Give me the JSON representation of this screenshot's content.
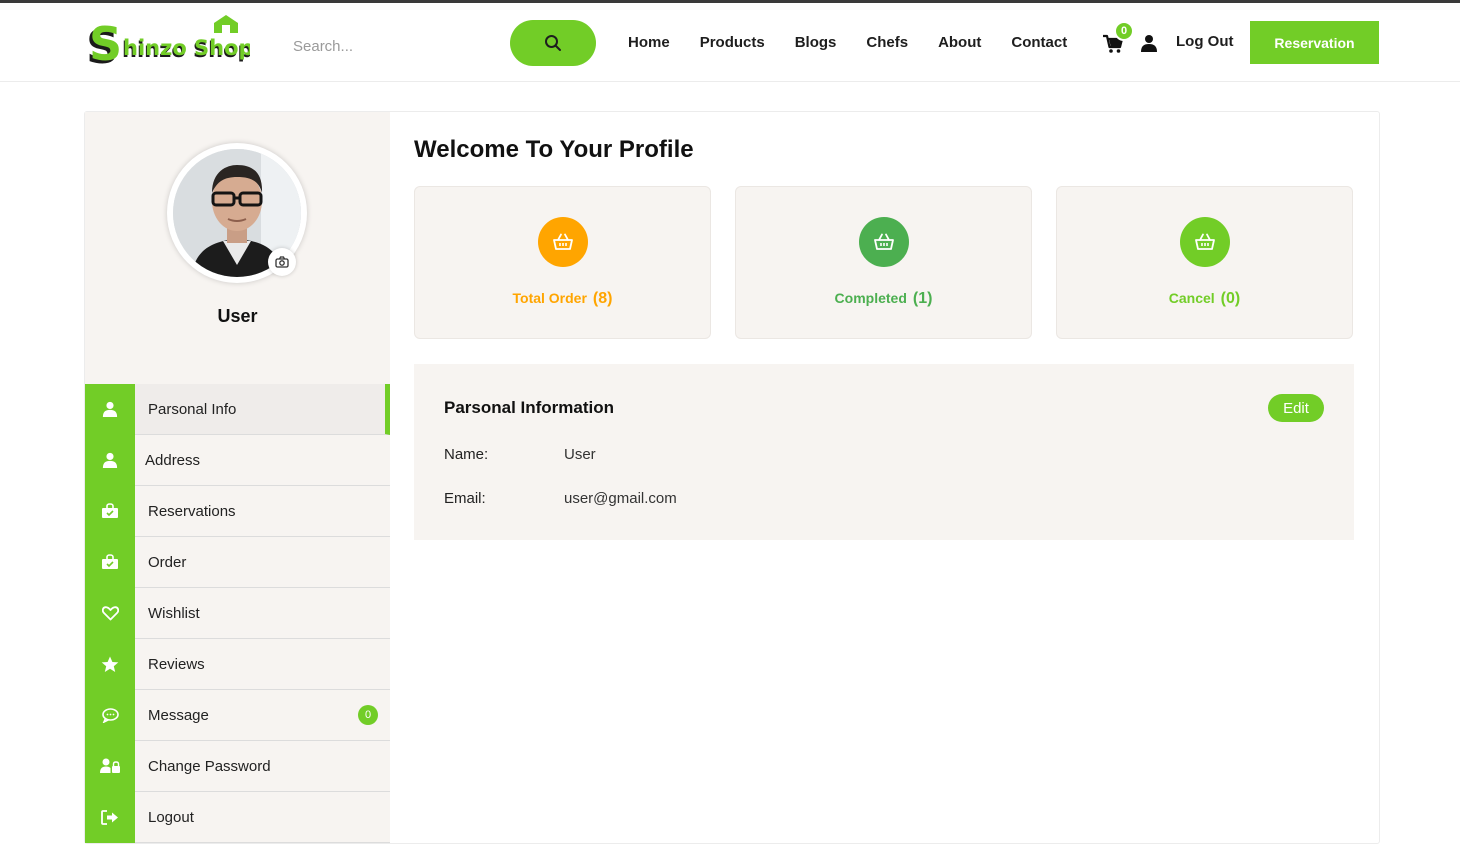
{
  "brand": {
    "name": "Shinzo Shop",
    "accent": "#72cd27"
  },
  "search": {
    "placeholder": "Search..."
  },
  "nav": {
    "items": [
      "Home",
      "Products",
      "Blogs",
      "Chefs",
      "About",
      "Contact"
    ]
  },
  "header": {
    "cart_count": "0",
    "logout_label": "Log Out",
    "reservation_label": "Reservation"
  },
  "profile": {
    "name": "User"
  },
  "sidebar": {
    "items": [
      {
        "label": "Parsonal Info",
        "icon": "user-icon"
      },
      {
        "label": "Address",
        "icon": "user-icon"
      },
      {
        "label": "Reservations",
        "icon": "shopping-bag-icon"
      },
      {
        "label": "Order",
        "icon": "shopping-bag-icon"
      },
      {
        "label": "Wishlist",
        "icon": "heart-icon"
      },
      {
        "label": "Reviews",
        "icon": "star-icon"
      },
      {
        "label": "Message",
        "icon": "chat-icon",
        "badge": "0"
      },
      {
        "label": "Change Password",
        "icon": "user-lock-icon"
      },
      {
        "label": "Logout",
        "icon": "sign-out-icon"
      }
    ]
  },
  "main": {
    "title": "Welcome To Your Profile",
    "stats": [
      {
        "label": "Total Order",
        "count": "(8)",
        "color": "#ffa500",
        "text_color": "#ffa500"
      },
      {
        "label": "Completed",
        "count": "(1)",
        "color": "#4caf50",
        "text_color": "#4caf50"
      },
      {
        "label": "Cancel",
        "count": "(0)",
        "color": "#72cd27",
        "text_color": "#72cd27"
      }
    ],
    "personal": {
      "title": "Parsonal Information",
      "edit_label": "Edit",
      "name_label": "Name:",
      "name_value": "User",
      "email_label": "Email:",
      "email_value": "user@gmail.com"
    }
  }
}
